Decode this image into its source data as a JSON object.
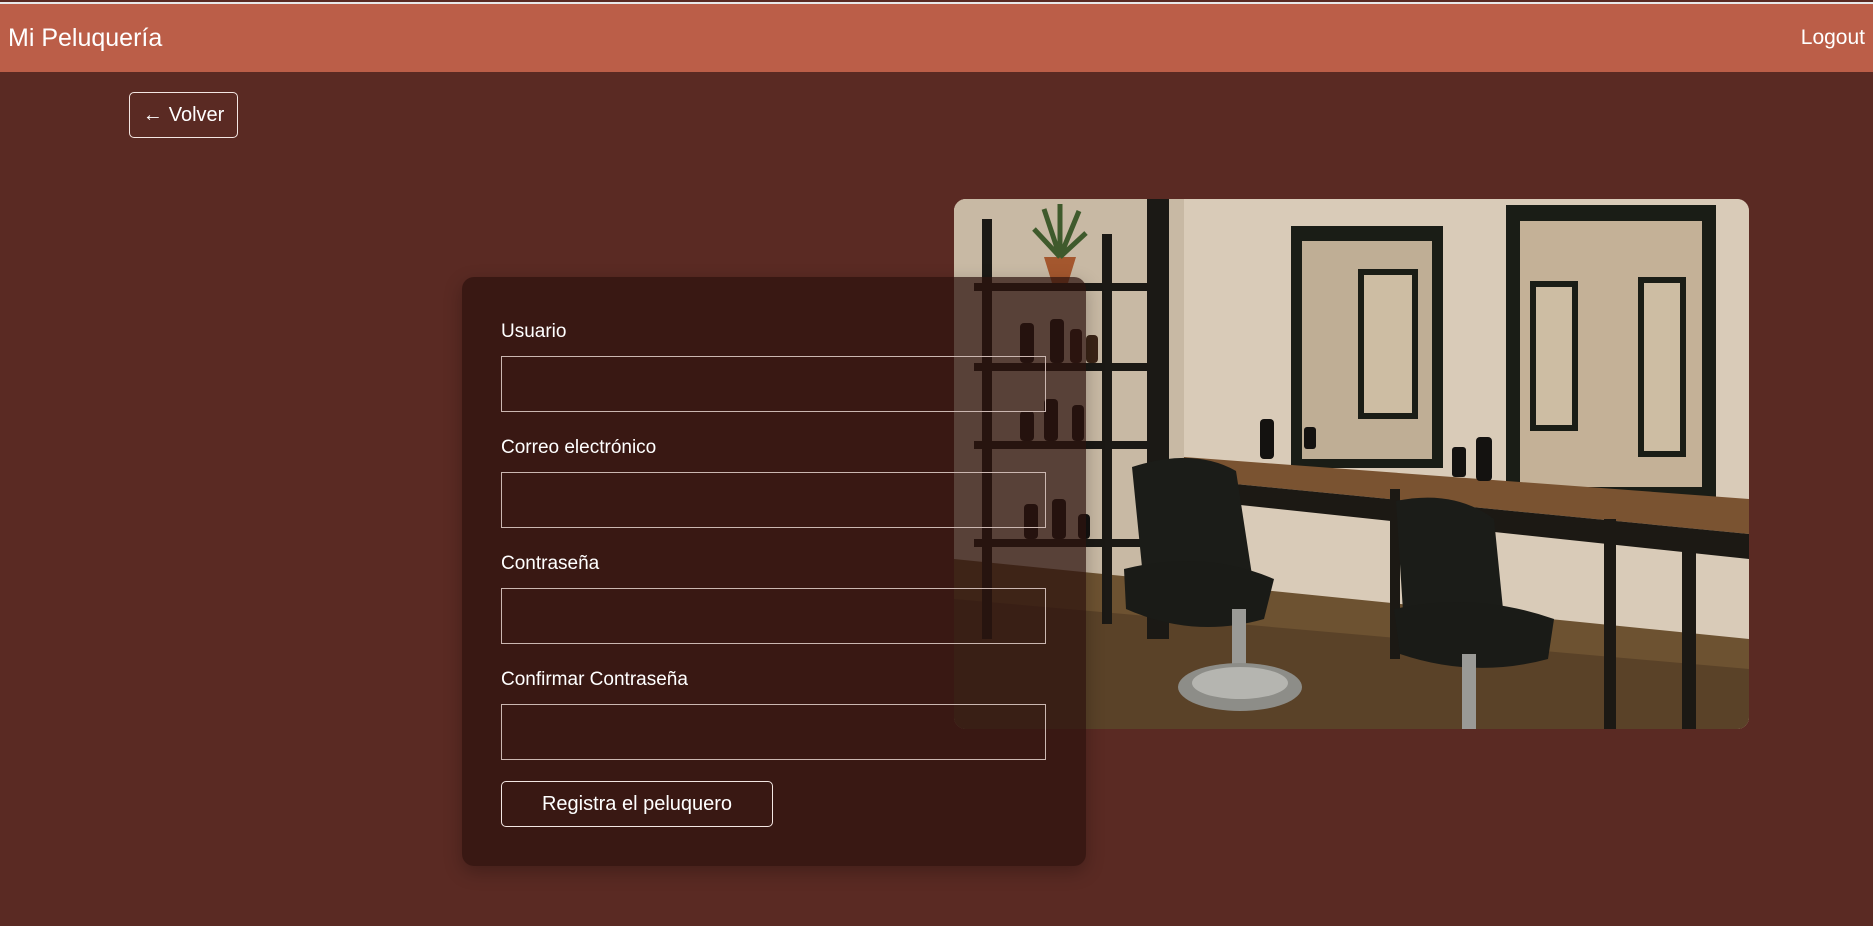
{
  "navbar": {
    "brand": "Mi Peluquería",
    "logout_label": "Logout"
  },
  "back_button": {
    "arrow": "←",
    "label": "Volver"
  },
  "form": {
    "fields": [
      {
        "label": "Usuario",
        "value": "",
        "type": "text"
      },
      {
        "label": "Correo electrónico",
        "value": "",
        "type": "email"
      },
      {
        "label": "Contraseña",
        "value": "",
        "type": "password"
      },
      {
        "label": "Confirmar Contraseña",
        "value": "",
        "type": "password"
      }
    ],
    "submit_label": "Registra el peluquero"
  },
  "colors": {
    "navbar": "#bb5e48",
    "background": "#5a2a23",
    "card": "#3a1a15"
  }
}
